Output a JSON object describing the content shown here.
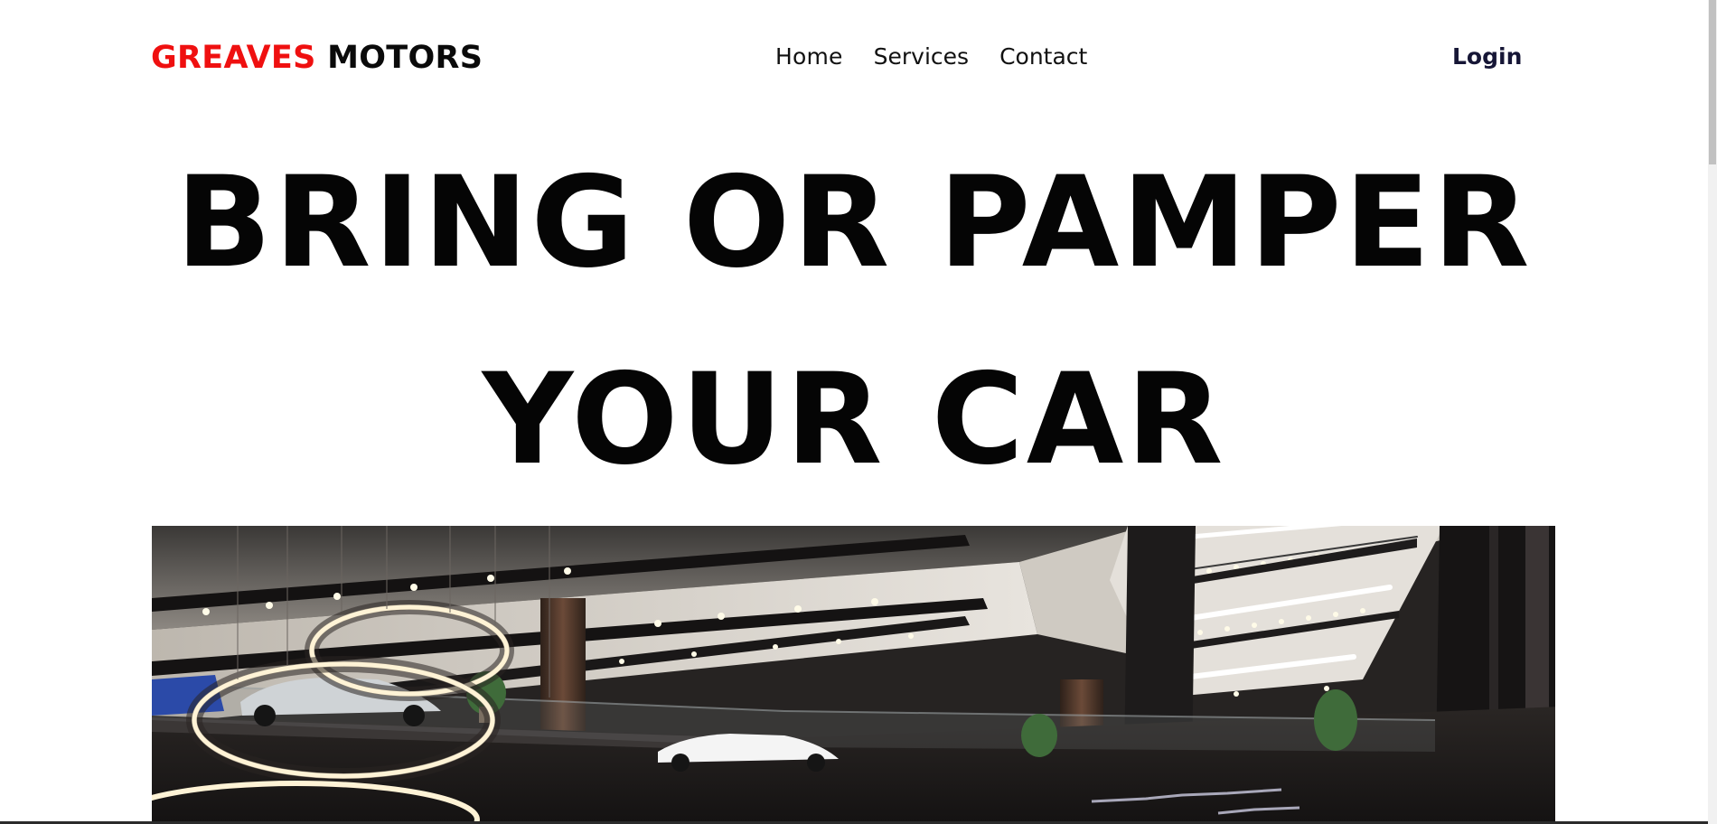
{
  "navbar": {
    "brand_part_1": "GREAVES",
    "brand_part_2": " MOTORS",
    "links": [
      {
        "label": "Home"
      },
      {
        "label": "Services"
      },
      {
        "label": "Contact"
      }
    ],
    "login_label": "Login"
  },
  "hero": {
    "line_1": "BRING OR PAMPER",
    "line_2": "YOUR CAR"
  },
  "colors": {
    "brand_red": "#ef1010",
    "text_dark": "#0a0a0a",
    "login_navy": "#161636"
  }
}
